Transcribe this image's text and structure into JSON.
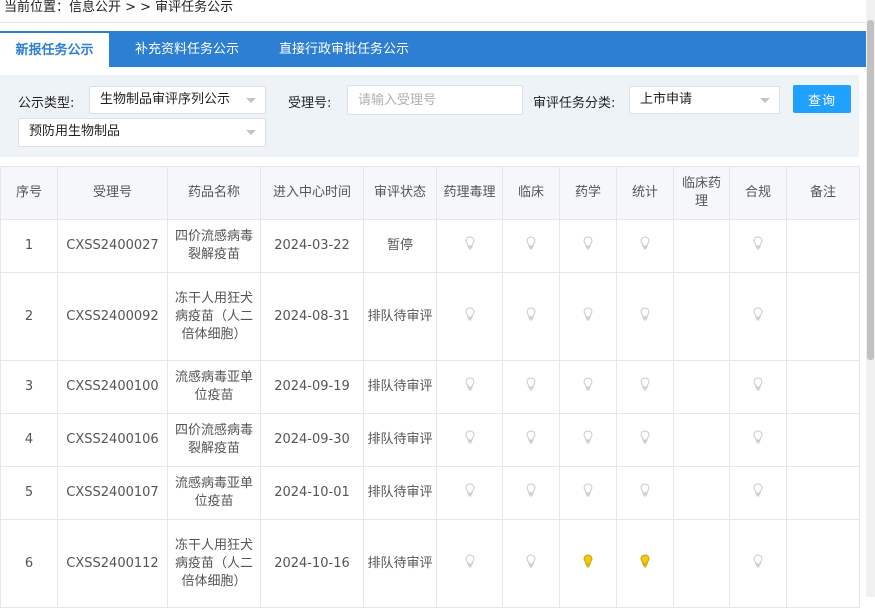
{
  "breadcrumb": "当前位置：信息公开 > > 审评任务公示",
  "tabs": [
    {
      "label": "新报任务公示",
      "active": true
    },
    {
      "label": "补充资料任务公示",
      "active": false
    },
    {
      "label": "直接行政审批任务公示",
      "active": false
    }
  ],
  "filters": {
    "type_label": "公示类型:",
    "type_value": "生物制品审评序列公示",
    "accept_label": "受理号:",
    "accept_placeholder": "请输入受理号",
    "category_label": "审评任务分类:",
    "category_value": "上市申请",
    "subcategory_value": "预防用生物制品",
    "search_button": "查询"
  },
  "table": {
    "headers": [
      "序号",
      "受理号",
      "药品名称",
      "进入中心时间",
      "审评状态",
      "药理毒理",
      "临床",
      "药学",
      "统计",
      "临床药理",
      "合规",
      "备注"
    ],
    "rows": [
      {
        "no": "1",
        "accept_no": "CXSS2400027",
        "name": "四价流感病毒裂解疫苗",
        "date": "2024-03-22",
        "status": "暂停",
        "bulbs": [
          "off",
          "off",
          "off",
          "off",
          "none",
          "off"
        ],
        "note": ""
      },
      {
        "no": "2",
        "accept_no": "CXSS2400092",
        "name": "冻干人用狂犬病疫苗（人二倍体细胞）",
        "date": "2024-08-31",
        "status": "排队待审评",
        "bulbs": [
          "off",
          "off",
          "off",
          "off",
          "none",
          "off"
        ],
        "note": ""
      },
      {
        "no": "3",
        "accept_no": "CXSS2400100",
        "name": "流感病毒亚单位疫苗",
        "date": "2024-09-19",
        "status": "排队待审评",
        "bulbs": [
          "off",
          "off",
          "off",
          "off",
          "none",
          "off"
        ],
        "note": ""
      },
      {
        "no": "4",
        "accept_no": "CXSS2400106",
        "name": "四价流感病毒裂解疫苗",
        "date": "2024-09-30",
        "status": "排队待审评",
        "bulbs": [
          "off",
          "off",
          "off",
          "off",
          "none",
          "off"
        ],
        "note": ""
      },
      {
        "no": "5",
        "accept_no": "CXSS2400107",
        "name": "流感病毒亚单位疫苗",
        "date": "2024-10-01",
        "status": "排队待审评",
        "bulbs": [
          "off",
          "off",
          "off",
          "off",
          "none",
          "off"
        ],
        "note": ""
      },
      {
        "no": "6",
        "accept_no": "CXSS2400112",
        "name": "冻干人用狂犬病疫苗（人二倍体细胞）",
        "date": "2024-10-16",
        "status": "排队待审评",
        "bulbs": [
          "off",
          "off",
          "on",
          "on",
          "none",
          "off"
        ],
        "note": ""
      }
    ]
  },
  "colors": {
    "accent": "#2d7fd3",
    "button": "#20a0ff",
    "bulb_on": "#f2c811",
    "bulb_off": "#d6d6d6"
  }
}
